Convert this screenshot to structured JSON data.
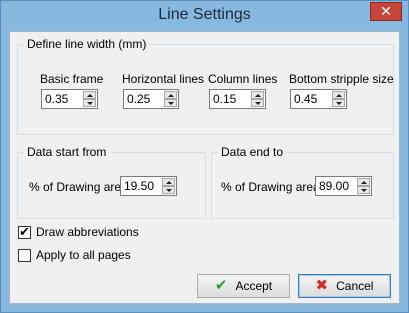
{
  "window": {
    "title": "Line Settings",
    "close_glyph": "✕"
  },
  "line_width": {
    "legend": "Define line width (mm)",
    "fields": [
      {
        "label": "Basic frame",
        "value": "0.35"
      },
      {
        "label": "Horizontal lines",
        "value": "0.25"
      },
      {
        "label": "Column lines",
        "value": "0.15"
      },
      {
        "label": "Bottom stripple size",
        "value": "0.45"
      }
    ]
  },
  "data_start": {
    "legend": "Data start from",
    "label": "% of Drawing area",
    "value": "19.50"
  },
  "data_end": {
    "legend": "Data end to",
    "label": "% of Drawing area",
    "value": "89.00"
  },
  "options": {
    "draw_abbreviations": {
      "label": "Draw abbreviations",
      "checked": true,
      "mark": "✔"
    },
    "apply_all_pages": {
      "label": "Apply to all pages",
      "checked": false
    }
  },
  "buttons": {
    "accept": {
      "label": "Accept",
      "icon": "check-icon",
      "glyph": "✔"
    },
    "cancel": {
      "label": "Cancel",
      "icon": "cross-icon",
      "glyph": "✖"
    }
  }
}
